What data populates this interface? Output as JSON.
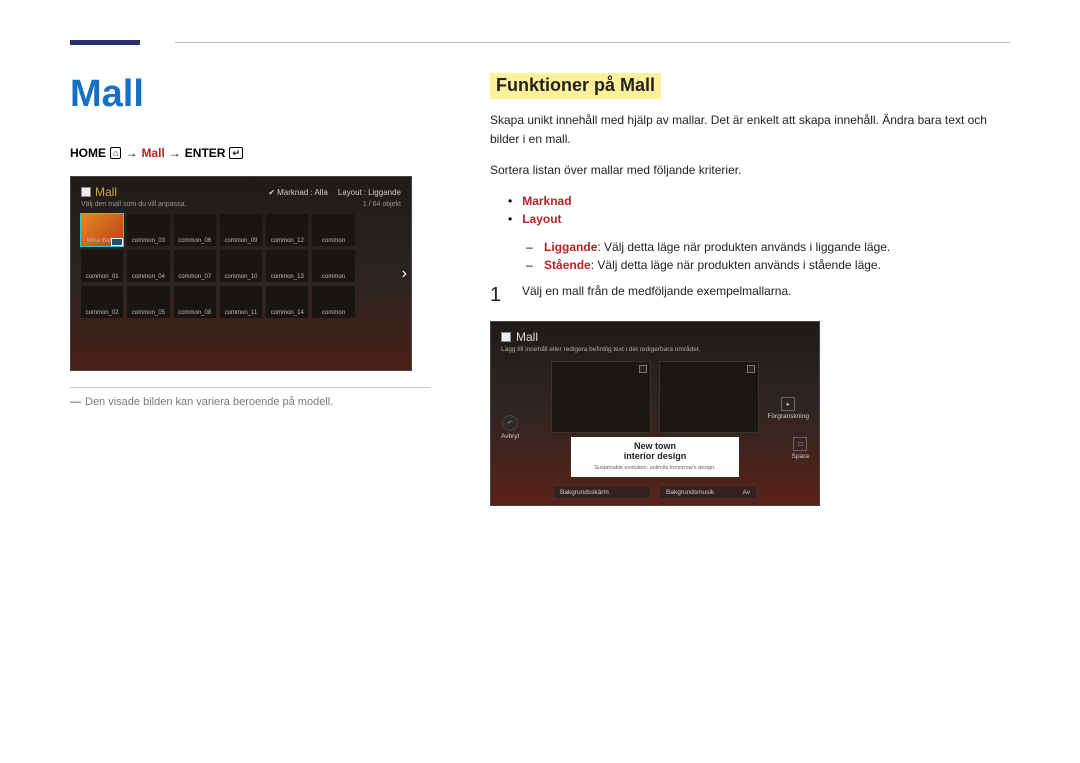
{
  "title": "Mall",
  "breadcrumb": {
    "home": "HOME",
    "mall": "Mall",
    "enter": "ENTER",
    "arrow": "→"
  },
  "shot1": {
    "title": "Mall",
    "subtitle": "Välj den mall som du vill anpassa.",
    "market_label": "Marknad",
    "market_value": "Alla",
    "layout_label": "Layout",
    "layout_value": "Liggande",
    "counter": "1 / 64 objekt",
    "first_tile": "Mina mallar"
  },
  "caption": "Den visade bilden kan variera beroende på modell.",
  "section_heading": "Funktioner på Mall",
  "para1": "Skapa unikt innehåll med hjälp av mallar. Det är enkelt att skapa innehåll. Ändra bara text och bilder i en mall.",
  "para2": "Sortera listan över mallar med följande kriterier.",
  "criteria": {
    "market": "Marknad",
    "layout": "Layout"
  },
  "layout_opts": {
    "liggande_label": "Liggande",
    "liggande_text": ": Välj detta läge när produkten används i liggande läge.",
    "staende_label": "Stående",
    "staende_text": ": Välj detta läge när produkten används i stående läge."
  },
  "step1_num": "1",
  "step1_text": "Välj en mall från de medföljande exempelmallarna.",
  "shot2": {
    "title": "Mall",
    "subtitle": "Lägg till innehåll eller redigera befintlig text i det redigerbara området.",
    "cancel": "Avbryt",
    "preview": "Förgranskning",
    "save": "Spara",
    "text1": "New town",
    "text2": "interior design",
    "tag": "Sustainable evolution: unlimits tomorrow's design.",
    "bg_image": "Bakgrundsskärm",
    "bg_music": "Bakgrundsmusik",
    "bg_music_val": "Av"
  }
}
